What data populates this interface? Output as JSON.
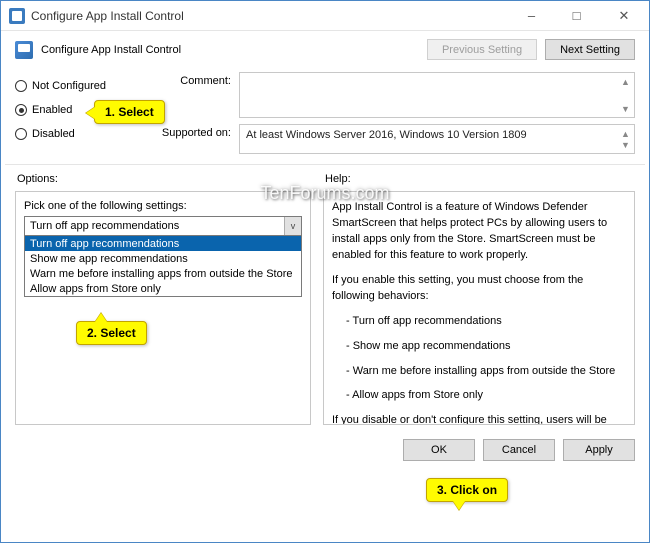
{
  "titlebar": {
    "text": "Configure App Install Control"
  },
  "header": {
    "title": "Configure App Install Control",
    "prev": "Previous Setting",
    "next": "Next Setting"
  },
  "state": {
    "radios": [
      {
        "label": "Not Configured",
        "checked": false
      },
      {
        "label": "Enabled",
        "checked": true
      },
      {
        "label": "Disabled",
        "checked": false
      }
    ]
  },
  "fields": {
    "comment_label": "Comment:",
    "comment_value": "",
    "supported_label": "Supported on:",
    "supported_value": "At least Windows Server 2016, Windows 10 Version 1809"
  },
  "columns": {
    "options": "Options:",
    "help": "Help:"
  },
  "options": {
    "panel_label": "Pick one of the following settings:",
    "selected": "Turn off app recommendations",
    "items": [
      "Turn off app recommendations",
      "Show me app recommendations",
      "Warn me before installing apps from outside the Store",
      "Allow apps from Store only"
    ]
  },
  "help": {
    "p1": "App Install Control is a feature of Windows Defender SmartScreen that helps protect PCs by allowing users to install apps only from the Store. SmartScreen must be enabled for this feature to work properly.",
    "p2": "If you enable this setting, you must choose from the following behaviors:",
    "b1": "- Turn off app recommendations",
    "b2": "- Show me app recommendations",
    "b3": "- Warn me before installing apps from outside the Store",
    "b4": "- Allow apps from Store only",
    "p3": "If you disable or don't configure this setting, users will be able to install apps from anywhere, including files downloaded from the Internet."
  },
  "buttons": {
    "ok": "OK",
    "cancel": "Cancel",
    "apply": "Apply"
  },
  "annotations": {
    "a1": "1. Select",
    "a2": "2. Select",
    "a3": "3. Click on"
  },
  "watermark": "TenForums.com"
}
